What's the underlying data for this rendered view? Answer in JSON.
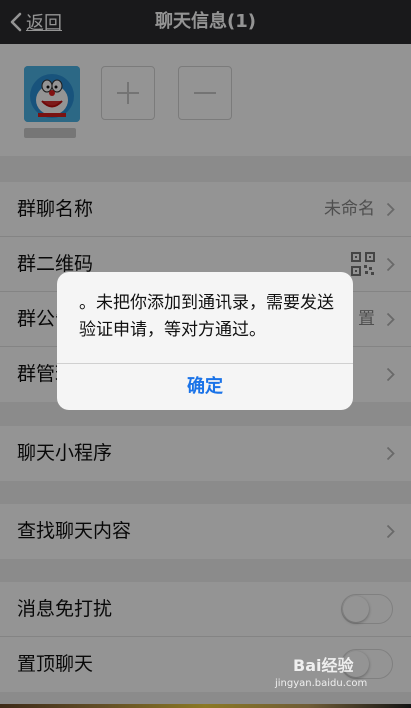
{
  "nav": {
    "back_label": "返回",
    "title": "聊天信息(1)"
  },
  "members": {
    "member_name": "用户"
  },
  "group1": {
    "rows": [
      {
        "label": "群聊名称",
        "value": "未命名"
      },
      {
        "label": "群二维码",
        "value": ""
      },
      {
        "label": "群公告",
        "value": "置"
      },
      {
        "label": "群管理",
        "value": ""
      }
    ]
  },
  "group2": {
    "label": "聊天小程序"
  },
  "group3": {
    "label": "查找聊天内容"
  },
  "group4": {
    "rows": [
      {
        "label": "消息免打扰"
      },
      {
        "label": "置顶聊天"
      }
    ]
  },
  "alert": {
    "message": "。未把你添加到通讯录，需要发送验证申请，等对方通过。",
    "confirm_label": "确定"
  },
  "watermark": {
    "logo": "Bai经验",
    "url": "jingyan.baidu.com"
  },
  "colors": {
    "nav_bg": "#2b2b2f",
    "page_bg": "#f0f0f0",
    "accent": "#1a73e8"
  }
}
